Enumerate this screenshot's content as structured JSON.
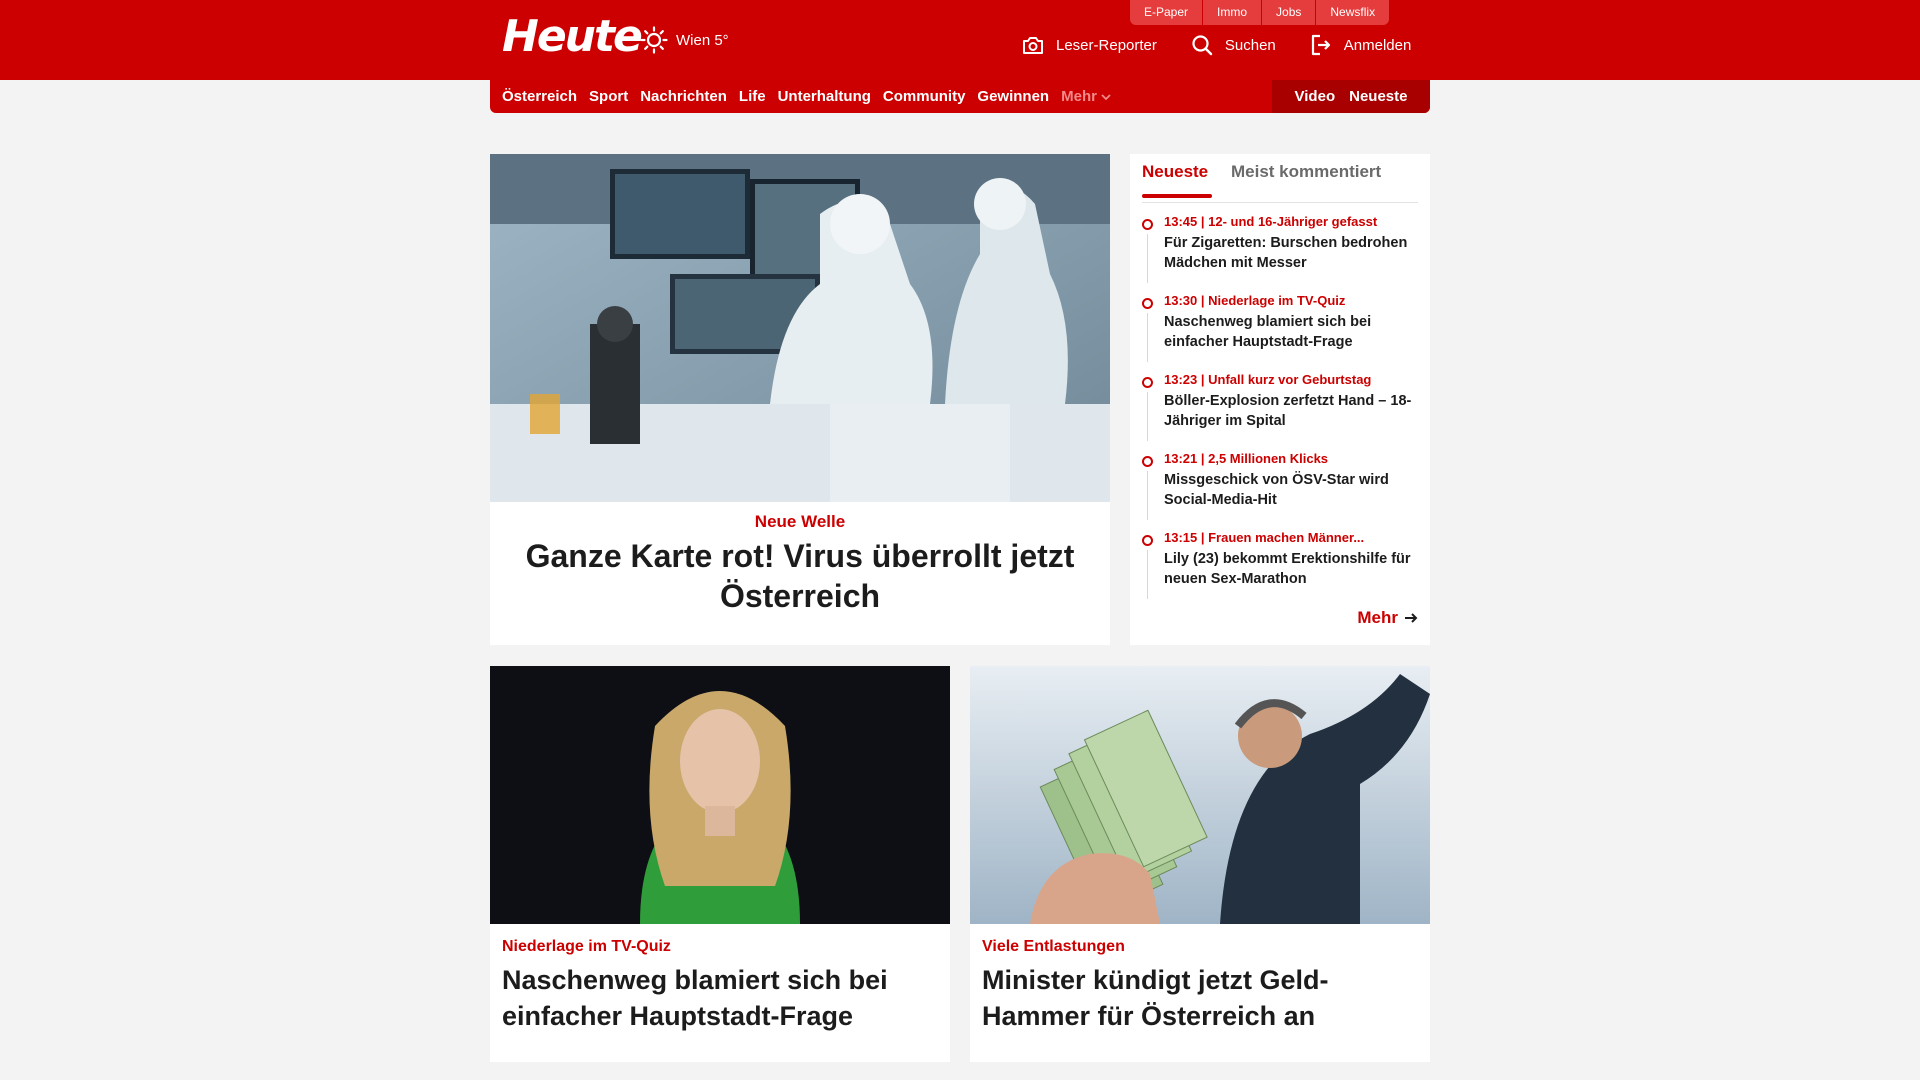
{
  "header": {
    "logo": "Heute",
    "weather": {
      "city_temp": "Wien 5°",
      "icon": "sun-icon"
    },
    "top_links": [
      "E-Paper",
      "Immo",
      "Jobs",
      "Newsflix"
    ],
    "actions": [
      {
        "label": "Leser-Reporter",
        "icon": "camera-icon"
      },
      {
        "label": "Suchen",
        "icon": "search-icon"
      },
      {
        "label": "Anmelden",
        "icon": "login-icon"
      }
    ],
    "brand_color": "#cc0000"
  },
  "nav": {
    "items": [
      "Österreich",
      "Sport",
      "Nachrichten",
      "Life",
      "Unterhaltung",
      "Community",
      "Gewinnen"
    ],
    "more": "Mehr",
    "right": [
      "Video",
      "Neueste"
    ]
  },
  "hero": {
    "kicker": "Neue Welle",
    "headline": "Ganze Karte rot! Virus überrollt jetzt Österreich"
  },
  "sidebar": {
    "tabs": [
      "Neueste",
      "Meist kommentiert"
    ],
    "items": [
      {
        "meta": "13:45 | 12- und 16-Jähriger gefasst",
        "title": "Für Zigaretten: Burschen bedrohen Mädchen mit Messer"
      },
      {
        "meta": "13:30 | Niederlage im TV-Quiz",
        "title": "Naschenweg blamiert sich bei einfacher Hauptstadt-Frage"
      },
      {
        "meta": "13:23 | Unfall kurz vor Geburtstag",
        "title": "Böller-Explosion zerfetzt Hand – 18-Jähriger im Spital"
      },
      {
        "meta": "13:21 | 2,5 Millionen Klicks",
        "title": "Missgeschick von ÖSV-Star wird Social-Media-Hit"
      },
      {
        "meta": "13:15 | Frauen machen Männer...",
        "title": "Lily (23) bekommt Erektionshilfe für neuen Sex-Marathon"
      }
    ],
    "more_label": "Mehr"
  },
  "cards": [
    {
      "kicker": "Niederlage im TV-Quiz",
      "headline": "Naschenweg blamiert sich bei einfacher Hauptstadt-Frage"
    },
    {
      "kicker": "Viele Entlastungen",
      "headline": "Minister kündigt jetzt Geld-Hammer für Österreich an"
    }
  ]
}
